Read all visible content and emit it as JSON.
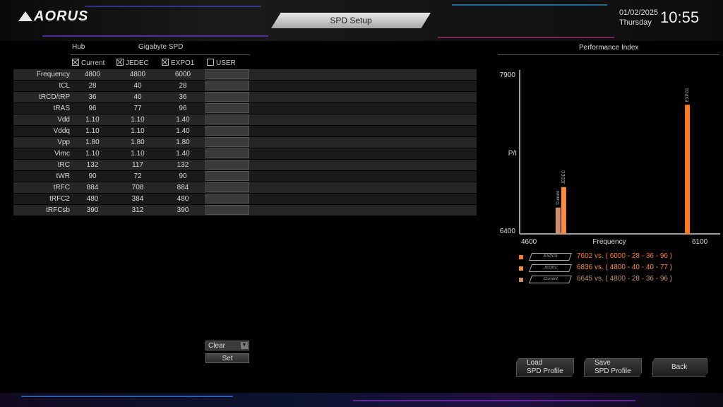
{
  "header": {
    "logo": "AORUS",
    "title": "SPD Setup",
    "date": "01/02/2025",
    "weekday": "Thursday",
    "time": "10:55"
  },
  "table": {
    "group_hub": "Hub",
    "group_spd": "Gigabyte SPD",
    "columns": [
      {
        "label": "Current",
        "checked": true
      },
      {
        "label": "JEDEC",
        "checked": true
      },
      {
        "label": "EXPO1",
        "checked": true
      },
      {
        "label": "USER",
        "checked": false
      }
    ],
    "rows": [
      {
        "label": "Frequency",
        "current": "4800",
        "jedec": "4800",
        "expo1": "6000"
      },
      {
        "label": "tCL",
        "current": "28",
        "jedec": "40",
        "expo1": "28"
      },
      {
        "label": "tRCD/tRP",
        "current": "36",
        "jedec": "40",
        "expo1": "36"
      },
      {
        "label": "tRAS",
        "current": "96",
        "jedec": "77",
        "expo1": "96"
      },
      {
        "label": "Vdd",
        "current": "1.10",
        "jedec": "1.10",
        "expo1": "1.40"
      },
      {
        "label": "Vddq",
        "current": "1.10",
        "jedec": "1.10",
        "expo1": "1.40"
      },
      {
        "label": "Vpp",
        "current": "1.80",
        "jedec": "1.80",
        "expo1": "1.80"
      },
      {
        "label": "Vimc",
        "current": "1.10",
        "jedec": "1.10",
        "expo1": "1.40"
      },
      {
        "label": "tRC",
        "current": "132",
        "jedec": "117",
        "expo1": "132"
      },
      {
        "label": "tWR",
        "current": "90",
        "jedec": "72",
        "expo1": "90"
      },
      {
        "label": "tRFC",
        "current": "884",
        "jedec": "708",
        "expo1": "884"
      },
      {
        "label": "tRFC2",
        "current": "480",
        "jedec": "384",
        "expo1": "480"
      },
      {
        "label": "tRFCsb",
        "current": "390",
        "jedec": "312",
        "expo1": "390"
      }
    ]
  },
  "controls": {
    "clear_label": "Clear",
    "set_label": "Set"
  },
  "chart_data": {
    "type": "bar",
    "title": "Performance Index",
    "ylabel": "P/I",
    "xlabel": "Frequency",
    "xlim": [
      4600,
      6100
    ],
    "ylim": [
      6400,
      7900
    ],
    "x_tick_labels": [
      "4600",
      "6100"
    ],
    "y_tick_labels": [
      "6400",
      "7900"
    ],
    "series": [
      {
        "name": "EXPO1",
        "x": 6000,
        "value": 7602,
        "color": "#ff7a1a",
        "desc": "vs. ( 6000  -  28  -  36  -  96 )"
      },
      {
        "name": "JEDEC",
        "x": 4800,
        "value": 6836,
        "color": "#ff8c3a",
        "desc": "vs. ( 4800  -  40  -  40  -  77 )"
      },
      {
        "name": "Current",
        "x": 4800,
        "value": 6645,
        "color": "#c89070",
        "desc": "vs. ( 4800  -  28  -  36  -  96 )"
      }
    ]
  },
  "buttons": {
    "load_line1": "Load",
    "load_line2": "SPD Profile",
    "save_line1": "Save",
    "save_line2": "SPD Profile",
    "back": "Back"
  }
}
